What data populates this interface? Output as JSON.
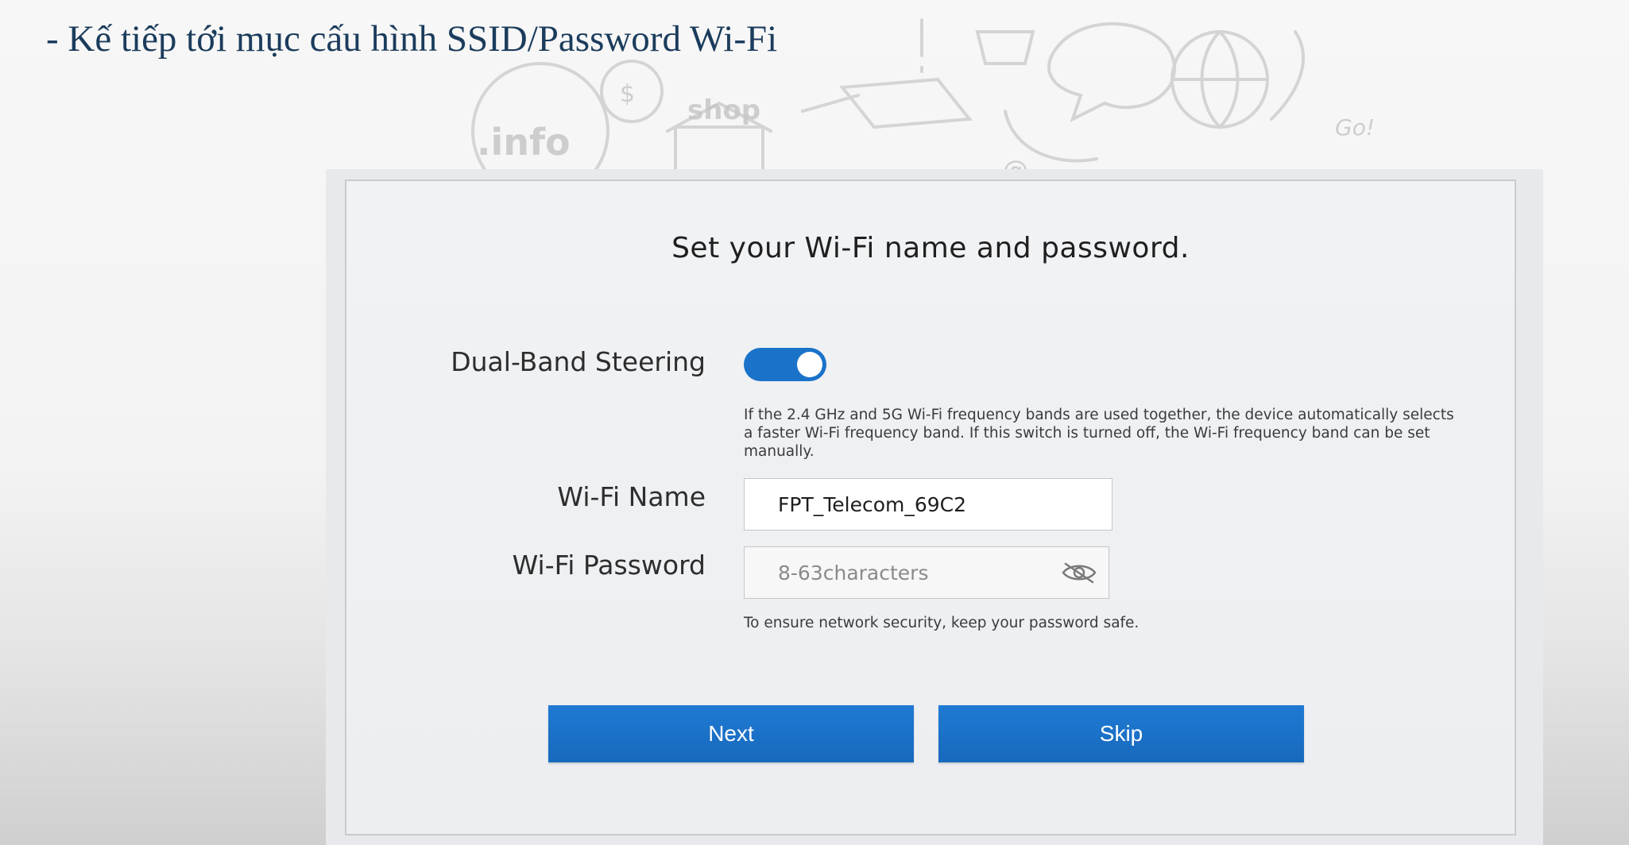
{
  "caption": "- Kế tiếp tới mục cấu hình SSID/Password Wi-Fi",
  "background": {
    "doodle_words": [
      ".info",
      "shop",
      "$",
      "!",
      "Go!",
      "@"
    ]
  },
  "setup": {
    "title": "Set your Wi-Fi name and password.",
    "dual_band": {
      "label": "Dual-Band Steering",
      "enabled": true,
      "help": "If the 2.4 GHz and 5G Wi-Fi frequency bands are used together, the device automatically selects a faster Wi-Fi frequency band. If this switch is turned off, the Wi-Fi frequency band can be set manually."
    },
    "wifi_name": {
      "label": "Wi-Fi Name",
      "value": "FPT_Telecom_69C2"
    },
    "wifi_password": {
      "label": "Wi-Fi Password",
      "value": "",
      "placeholder": "8-63characters",
      "note": "To ensure network security, keep your password safe."
    },
    "buttons": {
      "next": "Next",
      "skip": "Skip"
    }
  },
  "colors": {
    "accent": "#1a73c9",
    "caption_text": "#1b3c5c"
  },
  "icons": {
    "visibility": "eye-hidden-icon"
  }
}
